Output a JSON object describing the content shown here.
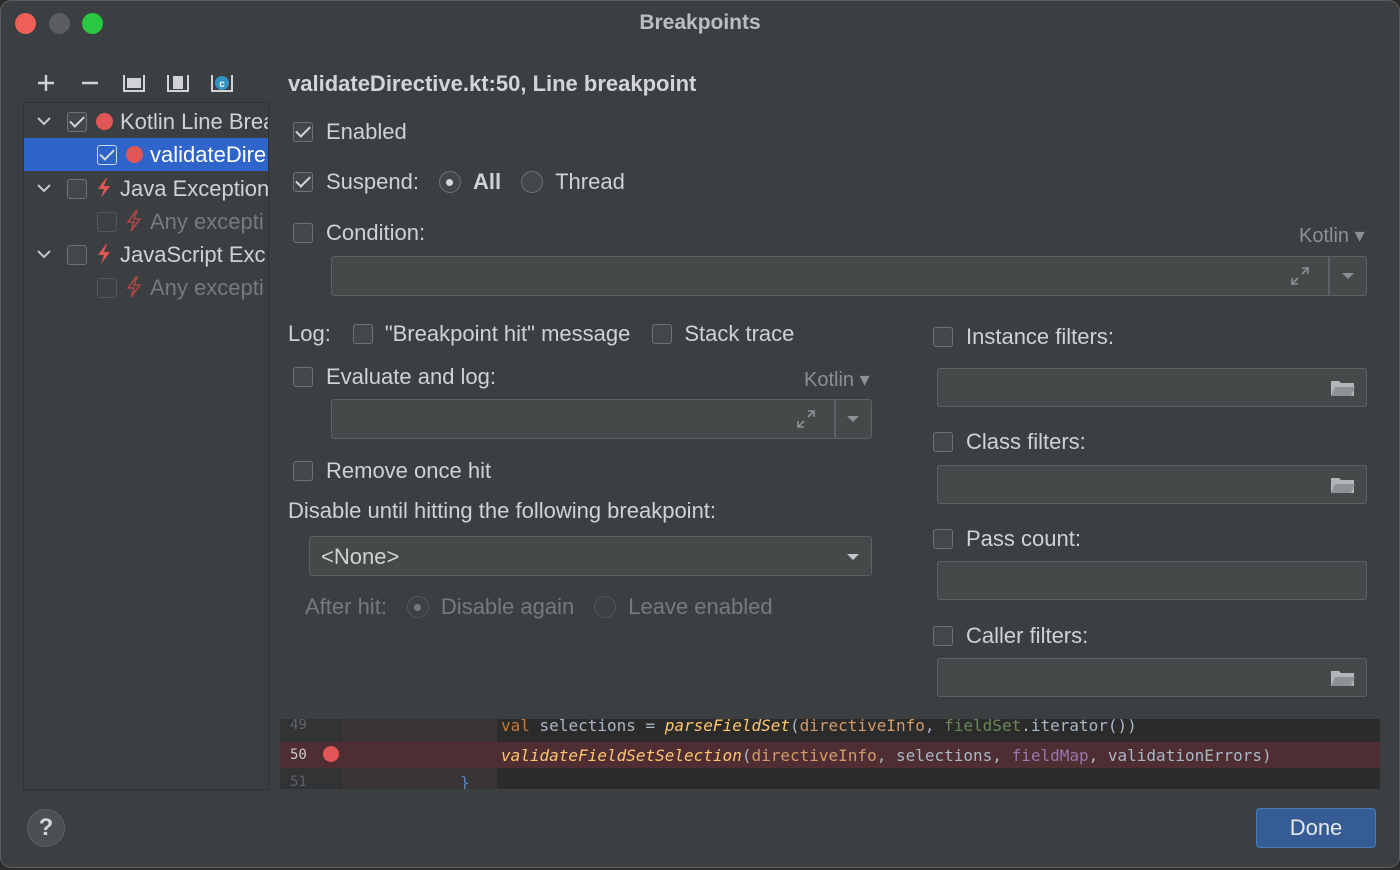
{
  "window": {
    "title": "Breakpoints"
  },
  "toolbar": {
    "icons": [
      "add-icon",
      "remove-icon",
      "folder-group-icon",
      "file-group-icon",
      "class-group-icon"
    ],
    "add": "+",
    "remove": "−"
  },
  "tree": [
    {
      "label": "Kotlin Line Brea",
      "checked": true,
      "icon": "red-dot-icon",
      "expanded": true
    },
    {
      "label": "validateDire",
      "checked": true,
      "icon": "red-dot-icon",
      "selected": true
    },
    {
      "label": "Java Exception",
      "checked": false,
      "icon": "bolt-icon",
      "expanded": true
    },
    {
      "label": "Any excepti",
      "checked": false,
      "icon": "bolt-icon",
      "disabled": true
    },
    {
      "label": "JavaScript Exc",
      "checked": false,
      "icon": "bolt-icon",
      "expanded": true
    },
    {
      "label": "Any excepti",
      "checked": false,
      "icon": "bolt-icon",
      "disabled": true
    }
  ],
  "detail": {
    "title": "validateDirective.kt:50, Line breakpoint",
    "enabled_label": "Enabled",
    "suspend_label": "Suspend:",
    "suspend_all": "All",
    "suspend_thread": "Thread",
    "condition_label": "Condition:",
    "condition_lang": "Kotlin",
    "condition_value": "",
    "log_label": "Log:",
    "log_hit_message": "\"Breakpoint hit\" message",
    "log_stack_trace": "Stack trace",
    "evaluate_label": "Evaluate and log:",
    "evaluate_lang": "Kotlin",
    "remove_once_hit": "Remove once hit",
    "disable_until": "Disable until hitting the following breakpoint:",
    "disable_until_value": "<None>",
    "after_hit_label": "After hit:",
    "after_hit_disable": "Disable again",
    "after_hit_leave": "Leave enabled",
    "instance_filters": "Instance filters:",
    "class_filters": "Class filters:",
    "pass_count": "Pass count:",
    "caller_filters": "Caller filters:"
  },
  "editor": {
    "lines": [
      {
        "number": "49",
        "code": "val selections = parseFieldSet(directiveInfo, fieldSet.iterator())"
      },
      {
        "number": "50",
        "code": "validateFieldSetSelection(directiveInfo, selections, fieldMap, validationErrors)",
        "breakpoint": true
      },
      {
        "number": "51",
        "code": "}"
      }
    ]
  },
  "footer": {
    "help": "?",
    "done": "Done"
  },
  "colors": {
    "accent": "#2f65ca",
    "breakpoint": "#e05555",
    "done_button": "#355c94"
  }
}
